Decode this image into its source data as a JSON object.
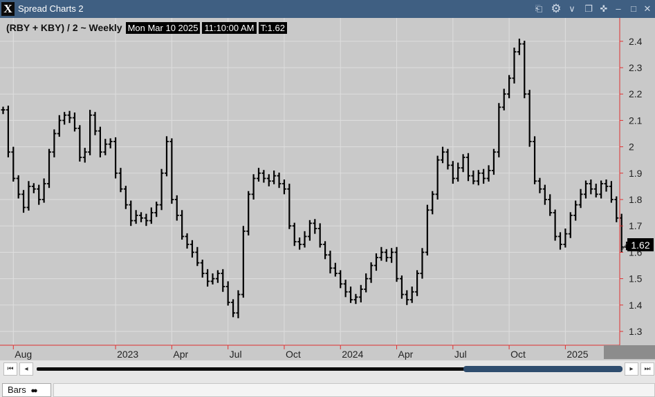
{
  "window": {
    "title": "Spread Charts 2",
    "logo_text": "X",
    "controls": [
      "link-icon",
      "gear-icon",
      "chevron-down-icon",
      "copy-icon",
      "move-icon",
      "minimize-icon",
      "maximize-icon",
      "close-icon"
    ]
  },
  "legend": {
    "expression": "(RBY + KBY) / 2 ~ Weekly",
    "date": "Mon Mar 10 2025",
    "time": "11:10:00 AM",
    "last": "T:1.62"
  },
  "colors": {
    "titlebar": "#3f5f82",
    "chart_background": "#c9c9c9",
    "price_line": "#000000",
    "axis_line": "#e03030",
    "scroll_thumb": "#2f4d6e"
  },
  "chart_data": {
    "type": "bar",
    "style": "HLC bars",
    "interval": "Weekly",
    "ylim": [
      1.25,
      2.5
    ],
    "y_ticks": [
      1.3,
      1.4,
      1.5,
      1.6,
      1.7,
      1.8,
      1.9,
      2.0,
      2.1,
      2.2,
      2.3,
      2.4
    ],
    "y_tick_labels": [
      "1.3",
      "1.4",
      "1.5",
      "1.6",
      "1.7",
      "1.8",
      "1.9",
      "2",
      "2.1",
      "2.2",
      "2.3",
      "2.4"
    ],
    "x_labels": [
      "Aug",
      "2023",
      "Apr",
      "Jul",
      "Oct",
      "2024",
      "Apr",
      "Jul",
      "Oct",
      "2025"
    ],
    "x_label_weeks": [
      2,
      22,
      33,
      44,
      55,
      66,
      77,
      88,
      99,
      110
    ],
    "last_value": 1.62,
    "last_value_label": "1.62",
    "grid": true,
    "closes": [
      2.14,
      1.98,
      1.88,
      1.82,
      1.77,
      1.85,
      1.84,
      1.8,
      1.86,
      1.98,
      2.05,
      2.1,
      2.12,
      2.11,
      2.07,
      1.96,
      1.98,
      2.12,
      2.06,
      1.98,
      2.01,
      2.02,
      1.9,
      1.84,
      1.78,
      1.72,
      1.74,
      1.73,
      1.72,
      1.75,
      1.78,
      1.9,
      2.02,
      1.8,
      1.74,
      1.66,
      1.63,
      1.6,
      1.56,
      1.52,
      1.49,
      1.5,
      1.52,
      1.47,
      1.41,
      1.37,
      1.44,
      1.68,
      1.82,
      1.88,
      1.9,
      1.88,
      1.87,
      1.89,
      1.86,
      1.84,
      1.7,
      1.64,
      1.63,
      1.66,
      1.71,
      1.69,
      1.63,
      1.59,
      1.54,
      1.52,
      1.48,
      1.45,
      1.42,
      1.43,
      1.46,
      1.5,
      1.55,
      1.58,
      1.6,
      1.58,
      1.6,
      1.5,
      1.44,
      1.42,
      1.45,
      1.52,
      1.6,
      1.76,
      1.82,
      1.95,
      1.98,
      1.93,
      1.88,
      1.92,
      1.96,
      1.89,
      1.87,
      1.9,
      1.88,
      1.91,
      1.98,
      2.15,
      2.2,
      2.26,
      2.36,
      2.39,
      2.2,
      2.02,
      1.87,
      1.84,
      1.8,
      1.75,
      1.66,
      1.63,
      1.67,
      1.74,
      1.78,
      1.82,
      1.86,
      1.84,
      1.82,
      1.86,
      1.85,
      1.8,
      1.73,
      1.62,
      1.62
    ]
  },
  "scrollbar": {
    "first_label": "⏮",
    "prev_label": "◂",
    "next_label": "▸",
    "last_label": "⏭",
    "thumb_start": 0.729,
    "thumb_end": 1.0
  },
  "tabs": [
    {
      "label": "Bars",
      "icon": "chain-icon"
    }
  ]
}
